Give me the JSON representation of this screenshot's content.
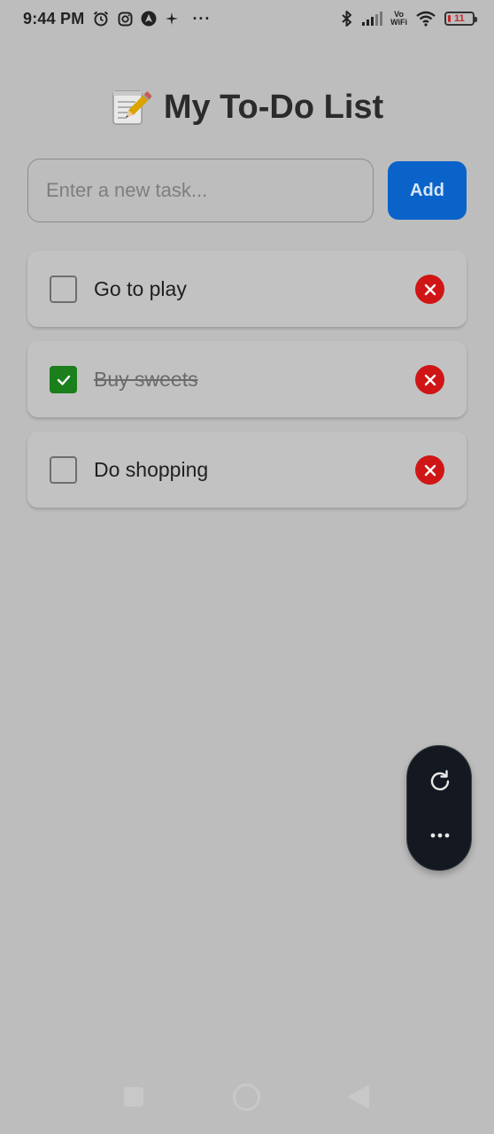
{
  "status_bar": {
    "time": "9:44 PM",
    "icons_left": [
      "alarm-icon",
      "instagram-icon",
      "nav-app-icon",
      "sparkle-icon"
    ],
    "more": "···",
    "icons_right": [
      "bluetooth-icon",
      "signal-icon",
      "vowifi-icon",
      "wifi-icon",
      "battery-icon"
    ],
    "vowifi_top": "Vo",
    "vowifi_bottom": "WiFi",
    "battery_level": "11"
  },
  "header": {
    "emoji": "memo-icon",
    "title": "My To-Do List"
  },
  "input": {
    "placeholder": "Enter a new task...",
    "value": "",
    "add_label": "Add"
  },
  "tasks": [
    {
      "text": "Go to play",
      "completed": false
    },
    {
      "text": "Buy sweets",
      "completed": true
    },
    {
      "text": "Do shopping",
      "completed": false
    }
  ],
  "colors": {
    "accent": "#0a63c9",
    "checked": "#1b7f1b",
    "delete": "#cf1515",
    "background": "#bdbdbd"
  },
  "floating_controls": [
    "refresh-icon",
    "more-horizontal-icon"
  ],
  "nav_bar": [
    "recents-button",
    "home-button",
    "back-button"
  ]
}
